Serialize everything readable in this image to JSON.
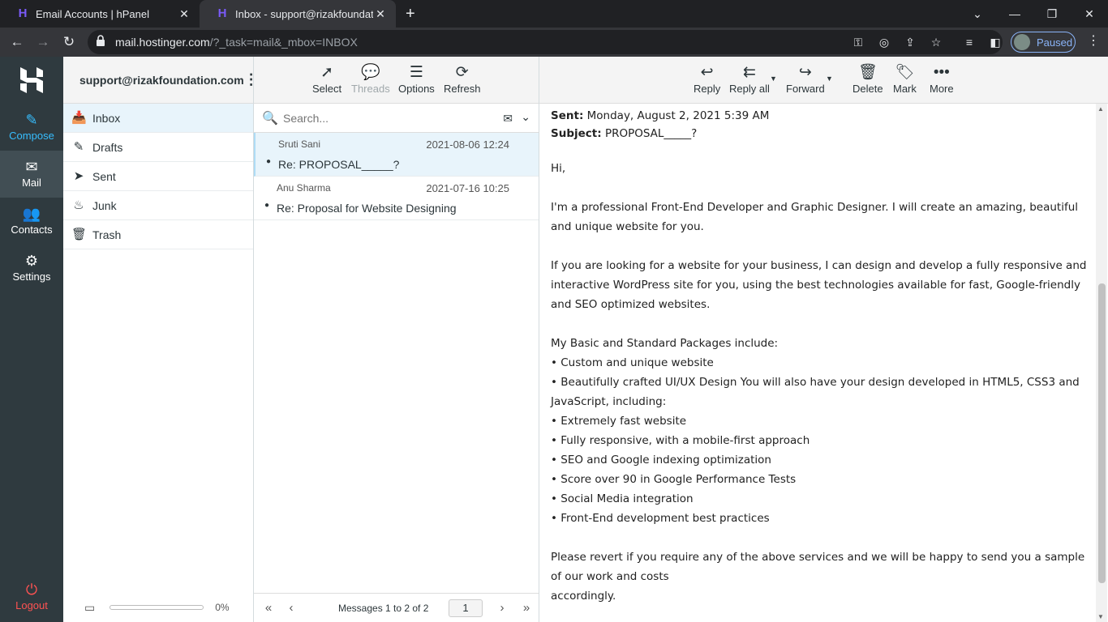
{
  "browser": {
    "tabs": [
      {
        "title": "Email Accounts | hPanel"
      },
      {
        "title": "Inbox - support@rizakfoundation"
      }
    ],
    "url_host": "mail.hostinger.com",
    "url_path": "/?_task=mail&_mbox=INBOX",
    "profile_status": "Paused"
  },
  "rail": {
    "compose": "Compose",
    "mail": "Mail",
    "contacts": "Contacts",
    "settings": "Settings",
    "logout": "Logout"
  },
  "account": "support@rizakfoundation.com",
  "folders": [
    {
      "label": "Inbox",
      "icon": "inbox-icon"
    },
    {
      "label": "Drafts",
      "icon": "pencil-icon"
    },
    {
      "label": "Sent",
      "icon": "paper-plane-icon"
    },
    {
      "label": "Junk",
      "icon": "fire-icon"
    },
    {
      "label": "Trash",
      "icon": "trash-icon"
    }
  ],
  "quota": {
    "percent_label": "0%",
    "used_fraction": 0
  },
  "list_toolbar": {
    "select": "Select",
    "threads": "Threads",
    "options": "Options",
    "refresh": "Refresh"
  },
  "search": {
    "placeholder": "Search..."
  },
  "messages": [
    {
      "from": "Sruti Sani",
      "date": "2021-08-06 12:24",
      "subject": "Re: PROPOSAL_____?",
      "selected": true
    },
    {
      "from": "Anu Sharma",
      "date": "2021-07-16 10:25",
      "subject": "Re: Proposal for Website Designing",
      "selected": false
    }
  ],
  "pager": {
    "count": "Messages 1 to 2 of 2",
    "page": "1"
  },
  "preview_toolbar": {
    "reply": "Reply",
    "reply_all": "Reply all",
    "forward": "Forward",
    "delete": "Delete",
    "mark": "Mark",
    "more": "More"
  },
  "email": {
    "sent_label": "Sent:",
    "sent_value": "Monday, August 2, 2021 5:39 AM",
    "subject_label": "Subject:",
    "subject_value": "PROPOSAL_____?",
    "greeting": "Hi,",
    "para1": "I'm a professional Front-End Developer and Graphic Designer. I will create an amazing, beautiful and unique website for you.",
    "para2": "If you are looking for a website for your business, I can design and develop a fully responsive and interactive WordPress site for you, using the best technologies available for fast, Google-friendly and SEO optimized websites.",
    "packages_intro": "My Basic and Standard Packages include:",
    "bullets": [
      "• Custom and unique website",
      "• Beautifully crafted UI/UX Design You will also have your design developed in HTML5, CSS3 and JavaScript, including:",
      "• Extremely fast website",
      "• Fully responsive, with a mobile-first approach",
      "• SEO and Google indexing optimization",
      "• Score over 90 in Google Performance Tests",
      "• Social Media integration",
      "• Front-End development best practices"
    ],
    "closing_line1": "Please revert if you require any of the above services and we will be happy to send you a sample of our work and costs",
    "closing_line2": "accordingly."
  }
}
